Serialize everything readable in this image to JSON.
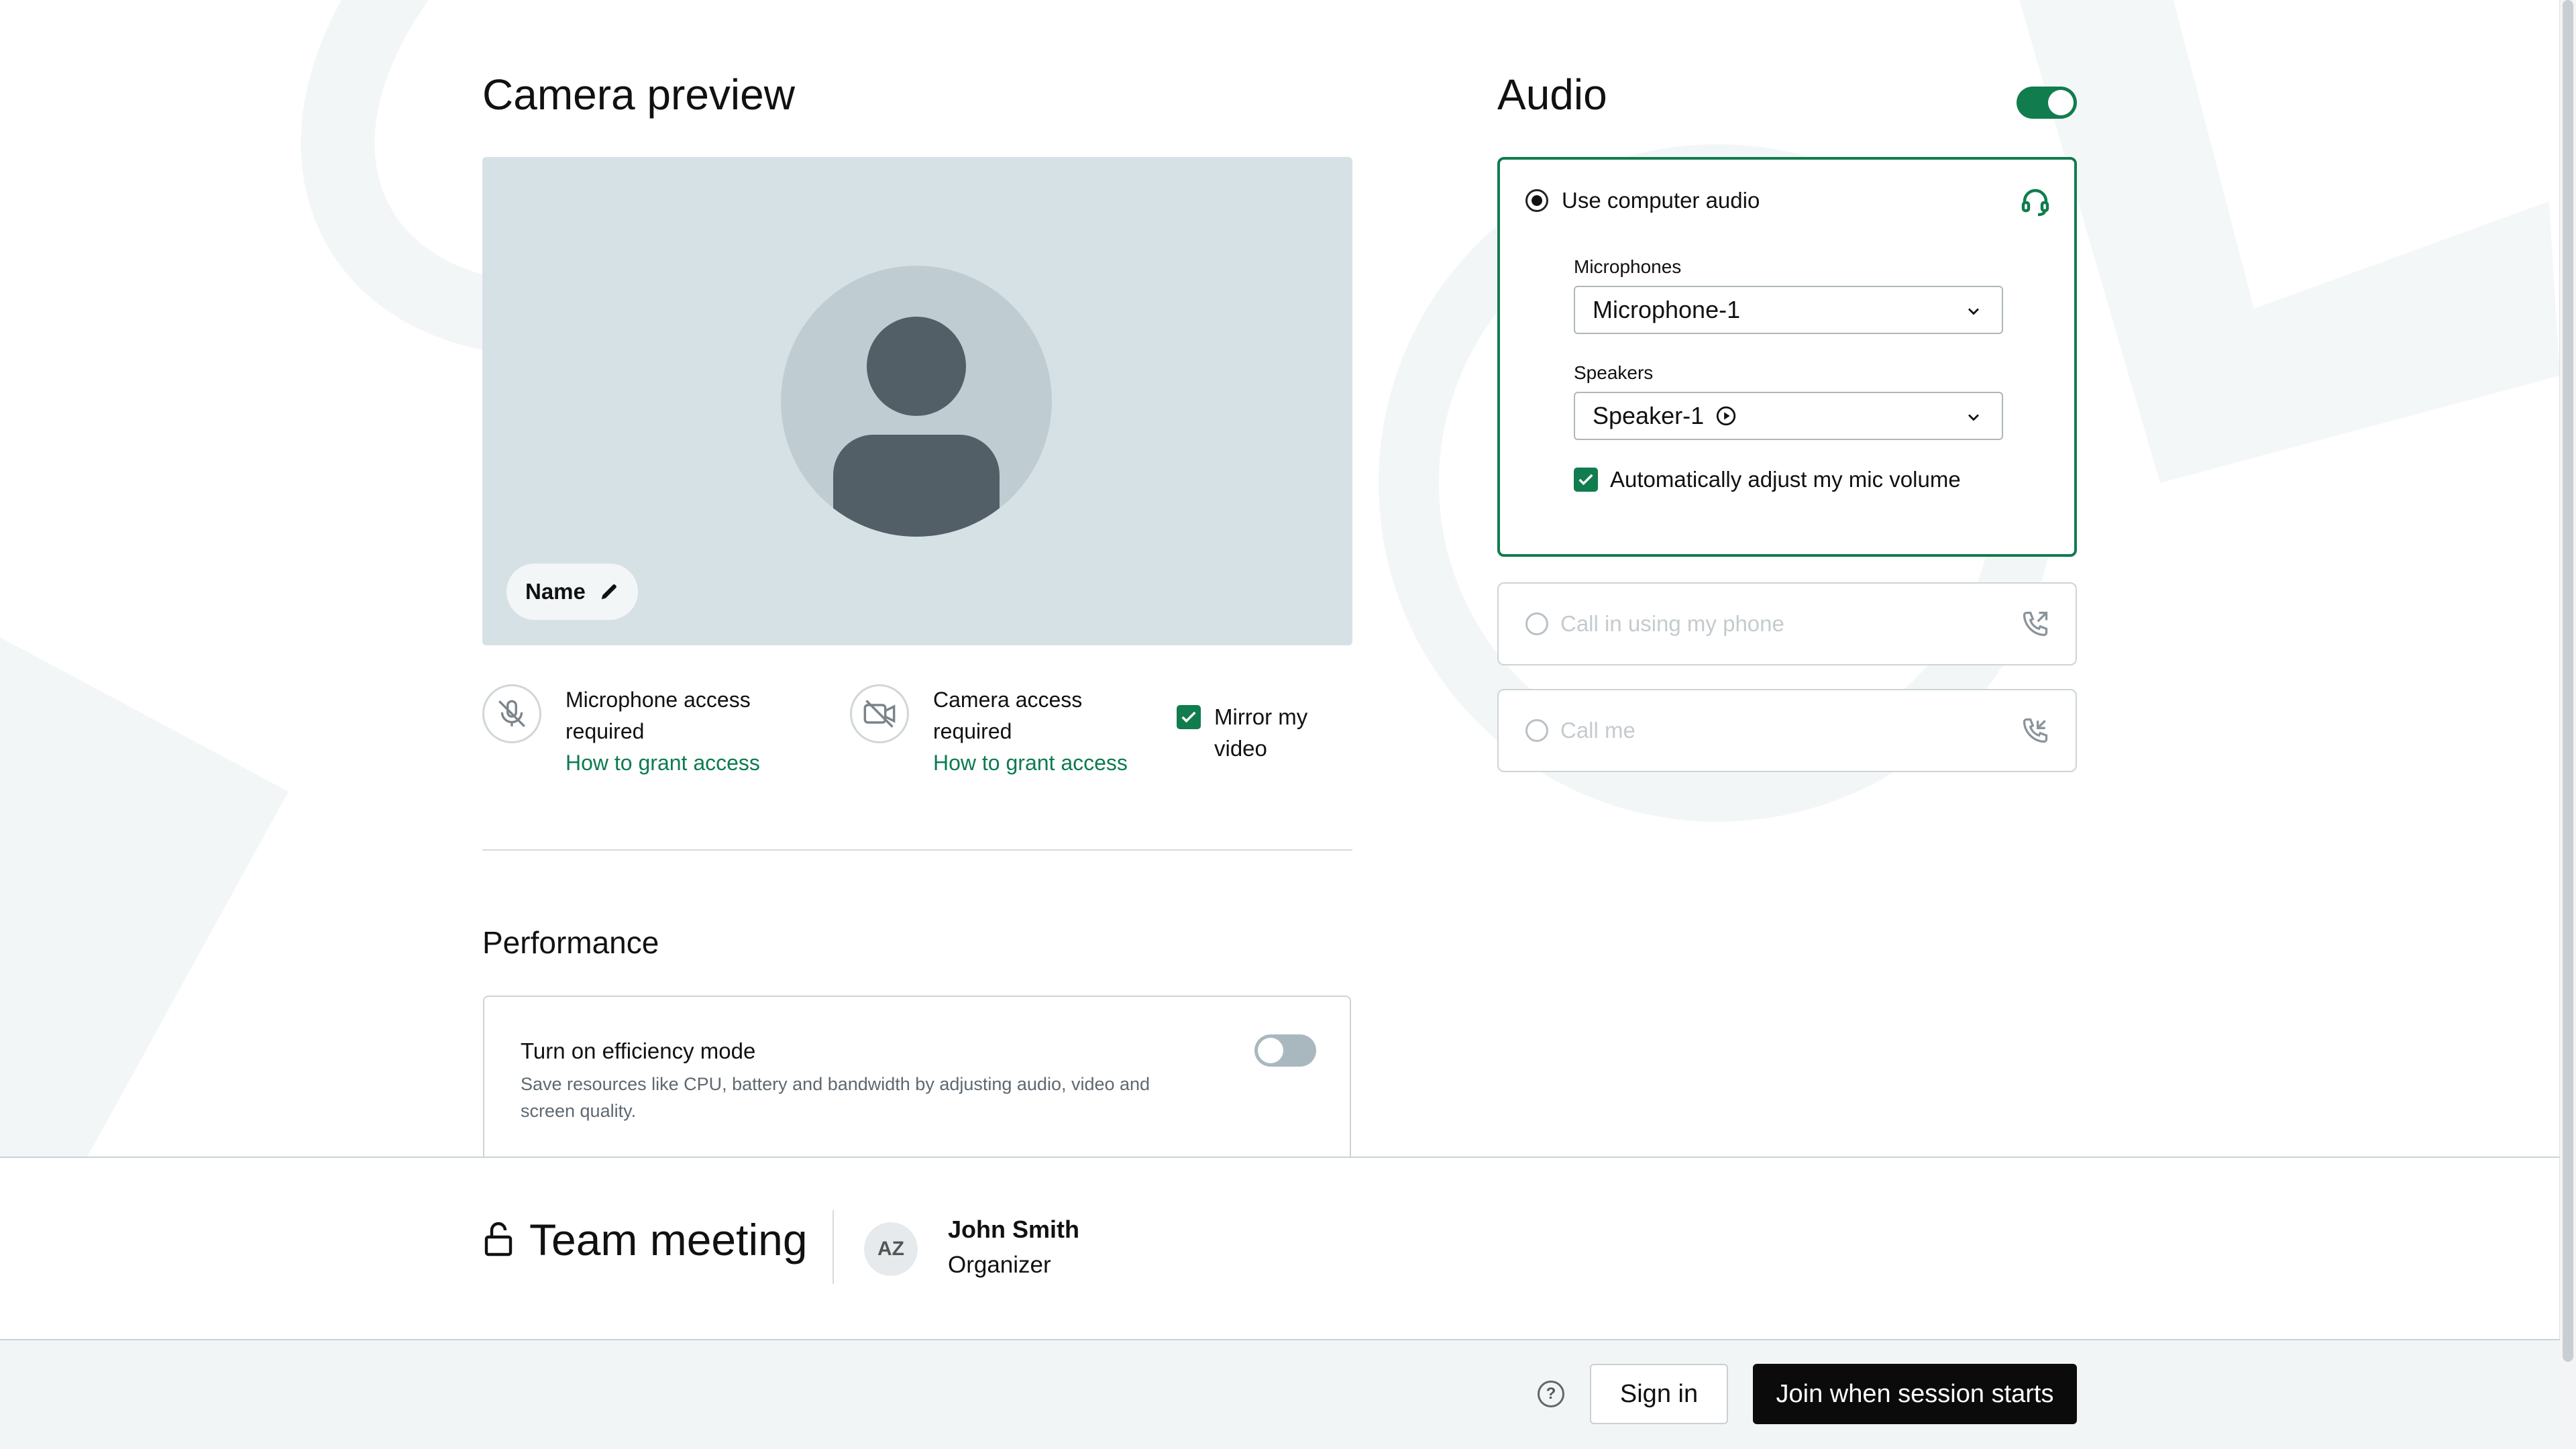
{
  "camera": {
    "title": "Camera preview",
    "name_label": "Name",
    "mic_access": {
      "line1": "Microphone access",
      "line2": "required",
      "link": "How to grant access"
    },
    "cam_access": {
      "line1": "Camera access",
      "line2": "required",
      "link": "How to grant access"
    },
    "mirror": {
      "line1": "Mirror my",
      "line2": "video",
      "checked": true
    }
  },
  "performance": {
    "title": "Performance",
    "efficiency_label": "Turn on efficiency mode",
    "efficiency_desc": "Save resources like CPU, battery and bandwidth by adjusting audio, video and screen quality.",
    "efficiency_on": false
  },
  "audio": {
    "title": "Audio",
    "enabled": true,
    "computer_audio_label": "Use computer audio",
    "microphones_label": "Microphones",
    "microphone_value": "Microphone-1",
    "speakers_label": "Speakers",
    "speaker_value": "Speaker-1",
    "auto_adjust_label": "Automatically adjust my mic volume",
    "auto_adjust_checked": true,
    "call_in_label": "Call in using my phone",
    "call_me_label": "Call me"
  },
  "meeting": {
    "title": "Team meeting",
    "organizer_initials": "AZ",
    "organizer_name": "John Smith",
    "organizer_role": "Organizer"
  },
  "footer": {
    "help_glyph": "?",
    "sign_in": "Sign in",
    "join": "Join when session starts"
  },
  "colors": {
    "accent": "#117c4e",
    "preview_bg": "#d6e1e6",
    "footer_bg": "#f2f5f6"
  }
}
